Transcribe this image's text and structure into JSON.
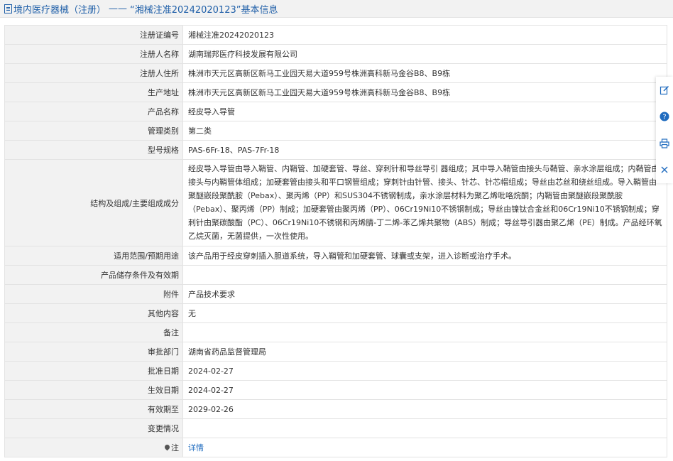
{
  "header": {
    "category": "境内医疗器械（注册）",
    "separator": "——",
    "title": "“湘械注准20242020123”基本信息"
  },
  "rows": [
    {
      "label": "注册证编号",
      "value": "湘械注准20242020123"
    },
    {
      "label": "注册人名称",
      "value": "湖南瑞邦医疗科技发展有限公司"
    },
    {
      "label": "注册人住所",
      "value": "株洲市天元区高新区新马工业园天易大道959号株洲高科新马金谷B8、B9栋"
    },
    {
      "label": "生产地址",
      "value": "株洲市天元区高新区新马工业园天易大道959号株洲高科新马金谷B8、B9栋"
    },
    {
      "label": "产品名称",
      "value": "经皮导入导管"
    },
    {
      "label": "管理类别",
      "value": "第二类"
    },
    {
      "label": "型号规格",
      "value": "PAS-6Fr-18、PAS-7Fr-18"
    },
    {
      "label": "结构及组成/主要组成成分",
      "value": "经皮导入导管由导入鞘管、内鞘管、加硬套管、导丝、穿刺针和导丝导引 器组成；其中导入鞘管由接头与鞘管、亲水涂层组成；内鞘管由接头与内鞘管体组成；加硬套管由接头和平口钢管组成；穿刺针由针管、接头、针芯、针芯帽组成；导丝由芯丝和绕丝组成。导入鞘管由聚醚嵌段聚酰胺（Pebax）、聚丙烯（PP）和SUS304不锈钢制成，亲水涂层材料为聚乙烯吡咯烷酮；内鞘管由聚醚嵌段聚酰胺（Pebax）、聚丙烯（PP）制成；加硬套管由聚丙烯（PP）、06Cr19Ni10不锈钢制成；导丝由镍钛合金丝和06Cr19Ni10不锈钢制成；穿刺针由聚碳酸酯（PC）、06Cr19Ni10不锈钢和丙烯腈-丁二烯-苯乙烯共聚物（ABS）制成；导丝导引器由聚乙烯（PE）制成。产品经环氧乙烷灭菌，无菌提供，一次性使用。"
    },
    {
      "label": "适用范围/预期用途",
      "value": "该产品用于经皮穿刺插入胆道系统，导入鞘管和加硬套管、球囊或支架，进入诊断或治疗手术。"
    },
    {
      "label": "产品储存条件及有效期",
      "value": ""
    },
    {
      "label": "附件",
      "value": "产品技术要求"
    },
    {
      "label": "其他内容",
      "value": "无"
    },
    {
      "label": "备注",
      "value": ""
    },
    {
      "label": "审批部门",
      "value": "湖南省药品监督管理局"
    },
    {
      "label": "批准日期",
      "value": "2024-02-27"
    },
    {
      "label": "生效日期",
      "value": "2024-02-27"
    },
    {
      "label": "有效期至",
      "value": "2029-02-26"
    },
    {
      "label": "变更情况",
      "value": ""
    }
  ],
  "note_row": {
    "label": "注",
    "icon": "map-pin-icon",
    "link": "详情"
  },
  "side_tools": [
    "edit-icon",
    "help-icon",
    "print-icon",
    "close-icon"
  ]
}
